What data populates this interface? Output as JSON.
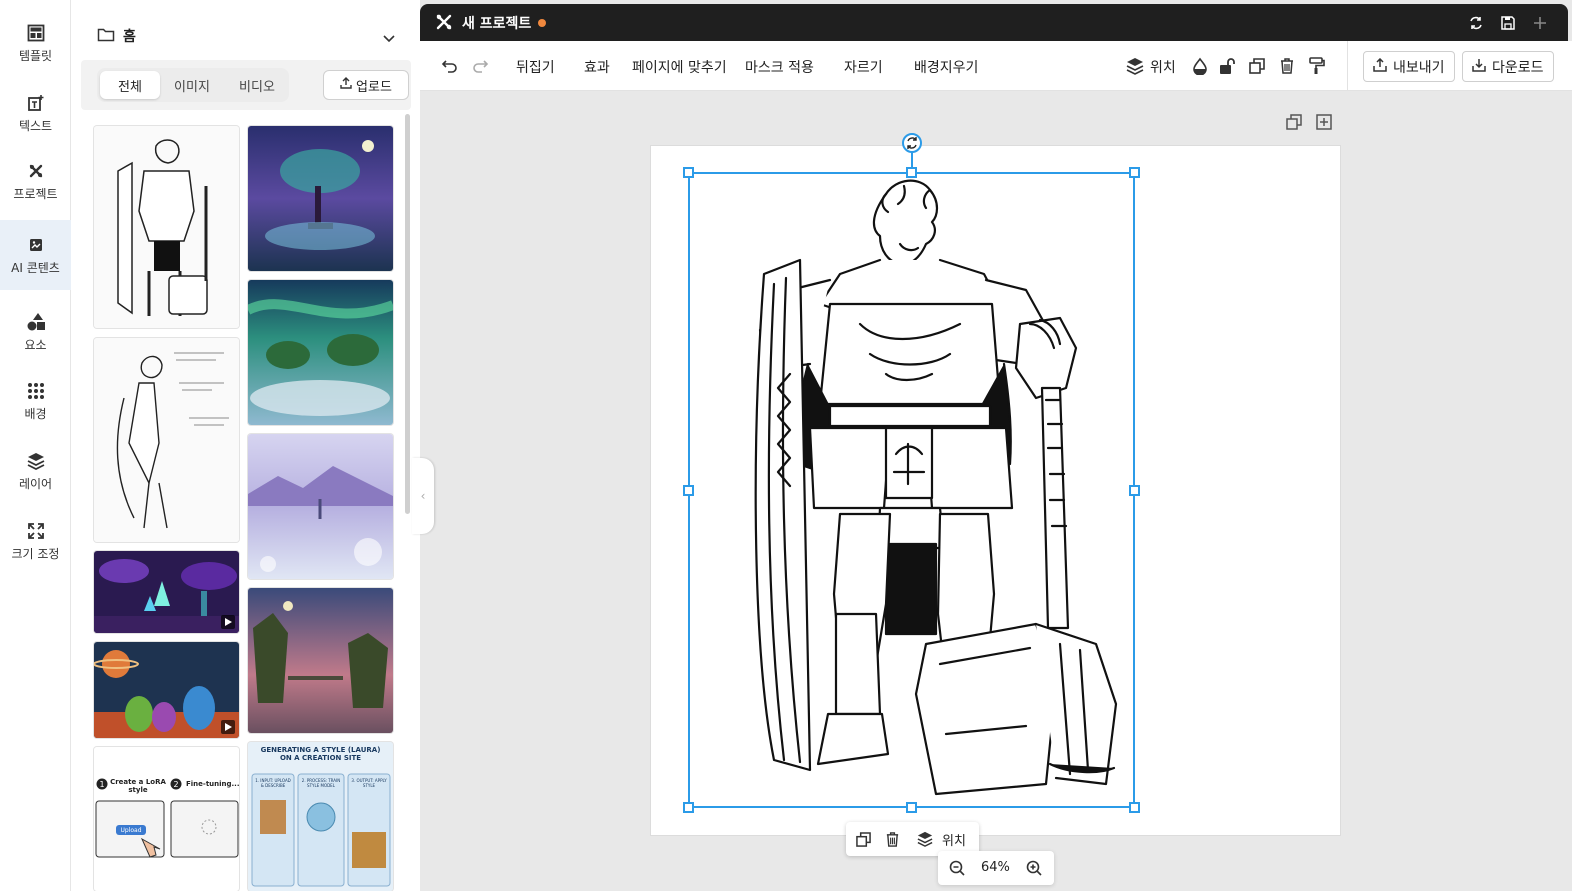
{
  "rail": {
    "items": [
      {
        "label": "템플릿",
        "icon": "template-icon"
      },
      {
        "label": "텍스트",
        "icon": "text-icon"
      },
      {
        "label": "프로젝트",
        "icon": "project-icon"
      },
      {
        "label": "AI 콘텐츠",
        "icon": "ai-content-icon",
        "active": true
      },
      {
        "label": "요소",
        "icon": "elements-icon"
      },
      {
        "label": "배경",
        "icon": "background-icon"
      },
      {
        "label": "레이어",
        "icon": "layers-icon"
      },
      {
        "label": "크기 조정",
        "icon": "resize-icon"
      }
    ]
  },
  "panel": {
    "folder_title": "홈",
    "filters": [
      "전체",
      "이미지",
      "비디오"
    ],
    "active_filter": "전체",
    "upload_label": "업로드",
    "thumbnails": [
      {
        "kind": "image",
        "desc": "knight sketch"
      },
      {
        "kind": "image",
        "desc": "aurora tree"
      },
      {
        "kind": "image",
        "desc": "aurora lotus"
      },
      {
        "kind": "image",
        "desc": "elf archer sketch"
      },
      {
        "kind": "image",
        "desc": "misty lake figure"
      },
      {
        "kind": "video",
        "desc": "alien crystal forest"
      },
      {
        "kind": "image",
        "desc": "floating islands"
      },
      {
        "kind": "video",
        "desc": "cute aliens"
      },
      {
        "kind": "image",
        "desc": "lora steps"
      },
      {
        "kind": "image",
        "desc": "infographic"
      }
    ],
    "lora_card": {
      "step1": "Create a LoRA style",
      "step2": "Fine-tuning...",
      "upload": "Upload"
    },
    "infographic": {
      "title": "GENERATING A STYLE (LAURA) ON A CREATION SITE",
      "col1": "1. INPUT: UPLOAD & DESCRIBE",
      "col2": "2. PROCESS: TRAIN STYLE MODEL",
      "col3": "3. OUTPUT: APPLY STYLE"
    }
  },
  "editor": {
    "title": "새 프로젝트",
    "unsaved_color": "#f0883e",
    "toolbar": {
      "flip": "뒤집기",
      "effects": "효과",
      "fit_page": "페이지에 맞추기",
      "apply_mask": "마스크 적용",
      "crop": "자르기",
      "remove_bg": "배경지우기",
      "position": "위치",
      "export": "내보내기",
      "download": "다운로드"
    },
    "floating": {
      "position": "위치"
    },
    "zoom": "64%"
  },
  "colors": {
    "selection": "#2b9be8",
    "titlebar": "#1f1f1f",
    "canvas_bg": "#e8e8e8",
    "rail_active": "#e9f0f8"
  }
}
